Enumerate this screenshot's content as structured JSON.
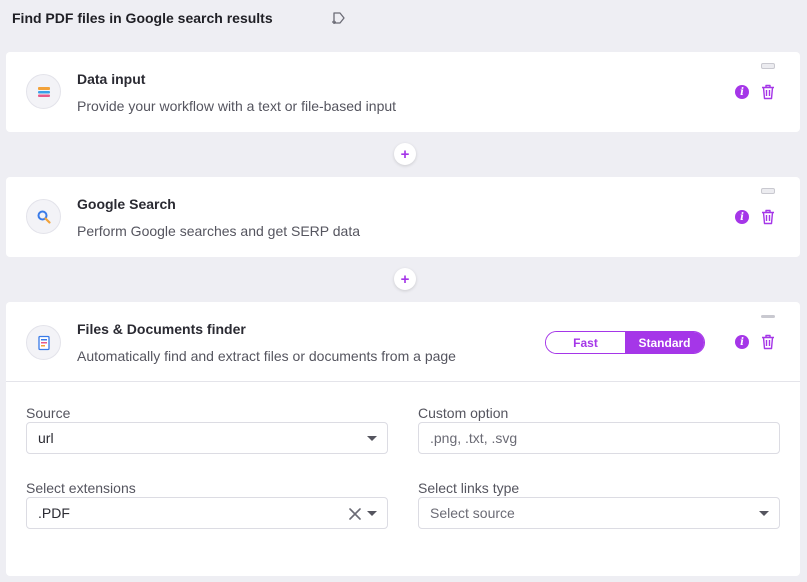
{
  "header": {
    "title": "Find PDF files in Google search results",
    "tag_icon": "tag-add-icon"
  },
  "steps": [
    {
      "title": "Data input",
      "description": "Provide your workflow with a text or file-based input",
      "icon": "data-input-icon"
    },
    {
      "title": "Google Search",
      "description": "Perform Google searches and get SERP data",
      "icon": "search-icon"
    },
    {
      "title": "Files & Documents finder",
      "description": "Automatically find and extract files or documents from a page",
      "icon": "document-icon"
    }
  ],
  "add_step_label": "+",
  "info_label": "i",
  "mode": {
    "options": [
      "Fast",
      "Standard"
    ],
    "selected": "Standard"
  },
  "config": {
    "source": {
      "label": "Source",
      "value": "url"
    },
    "custom_option": {
      "label": "Custom option",
      "placeholder": ".png, .txt, .svg"
    },
    "extensions": {
      "label": "Select extensions",
      "value": ".PDF"
    },
    "links_type": {
      "label": "Select links type",
      "placeholder": "Select source"
    }
  },
  "colors": {
    "accent": "#a536e8",
    "background": "#eeeef3",
    "card": "#ffffff"
  }
}
